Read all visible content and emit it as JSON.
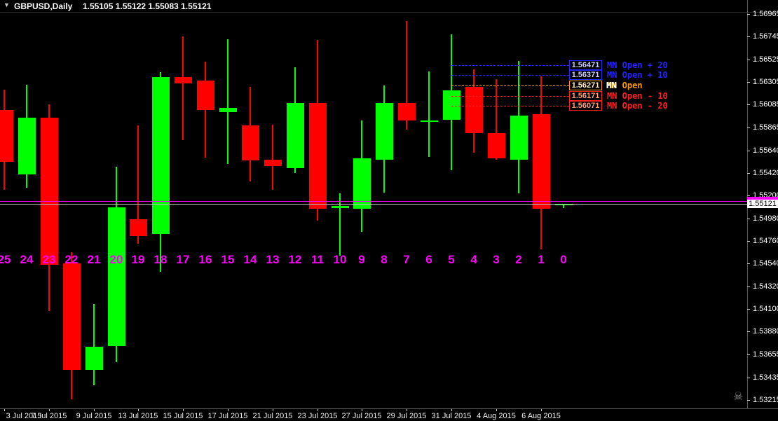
{
  "title": {
    "symbol_timeframe": "GBPUSD,Daily",
    "ohlc_quote": "1.55105 1.55122 1.55083 1.55121"
  },
  "icons": {
    "symbol_menu": "▼",
    "skull": "☠"
  },
  "price_axis": {
    "current_bid_label": "1.55121"
  },
  "chart_data": {
    "type": "candlestick",
    "title": "GBPUSD,Daily",
    "symbol": "GBPUSD",
    "timeframe": "Daily",
    "background": "#000000",
    "up_color": "#00FF00",
    "down_color": "#FF0000",
    "bar_number_color": "#FF00FF",
    "y_axis": {
      "ticks": [
        "1.56965",
        "1.56745",
        "1.56525",
        "1.56305",
        "1.56085",
        "1.55865",
        "1.55640",
        "1.55420",
        "1.55200",
        "1.54980",
        "1.54760",
        "1.54540",
        "1.54320",
        "1.54100",
        "1.53880",
        "1.53655",
        "1.53435",
        "1.53215"
      ],
      "range": [
        1.532,
        1.5698
      ]
    },
    "x_axis": {
      "labels": [
        {
          "text": "3 Jul 2015",
          "bar": 25
        },
        {
          "text": "7 Jul 2015",
          "bar": 23
        },
        {
          "text": "9 Jul 2015",
          "bar": 21
        },
        {
          "text": "13 Jul 2015",
          "bar": 19
        },
        {
          "text": "15 Jul 2015",
          "bar": 17
        },
        {
          "text": "17 Jul 2015",
          "bar": 15
        },
        {
          "text": "21 Jul 2015",
          "bar": 13
        },
        {
          "text": "23 Jul 2015",
          "bar": 11
        },
        {
          "text": "27 Jul 2015",
          "bar": 9
        },
        {
          "text": "29 Jul 2015",
          "bar": 7
        },
        {
          "text": "31 Jul 2015",
          "bar": 5
        },
        {
          "text": "4 Aug 2015",
          "bar": 3
        },
        {
          "text": "6 Aug 2015",
          "bar": 1
        }
      ]
    },
    "candles": [
      {
        "n": 25,
        "o": 1.5603,
        "h": 1.5623,
        "l": 1.5526,
        "c": 1.5553
      },
      {
        "n": 24,
        "o": 1.5541,
        "h": 1.5628,
        "l": 1.5528,
        "c": 1.5596
      },
      {
        "n": 23,
        "o": 1.5596,
        "h": 1.5609,
        "l": 1.5408,
        "c": 1.5453
      },
      {
        "n": 22,
        "o": 1.5454,
        "h": 1.5465,
        "l": 1.5322,
        "c": 1.5351
      },
      {
        "n": 21,
        "o": 1.5351,
        "h": 1.5415,
        "l": 1.5336,
        "c": 1.5373
      },
      {
        "n": 20,
        "o": 1.5374,
        "h": 1.5548,
        "l": 1.5358,
        "c": 1.5509
      },
      {
        "n": 19,
        "o": 1.5497,
        "h": 1.5588,
        "l": 1.5473,
        "c": 1.5481
      },
      {
        "n": 18,
        "o": 1.5483,
        "h": 1.564,
        "l": 1.5446,
        "c": 1.5635
      },
      {
        "n": 17,
        "o": 1.5635,
        "h": 1.5675,
        "l": 1.5574,
        "c": 1.5629
      },
      {
        "n": 16,
        "o": 1.5632,
        "h": 1.565,
        "l": 1.5557,
        "c": 1.5603
      },
      {
        "n": 15,
        "o": 1.5601,
        "h": 1.5672,
        "l": 1.5551,
        "c": 1.5605
      },
      {
        "n": 14,
        "o": 1.5588,
        "h": 1.5626,
        "l": 1.5534,
        "c": 1.5554
      },
      {
        "n": 13,
        "o": 1.5555,
        "h": 1.5589,
        "l": 1.5526,
        "c": 1.5549
      },
      {
        "n": 12,
        "o": 1.5547,
        "h": 1.5645,
        "l": 1.5542,
        "c": 1.561
      },
      {
        "n": 11,
        "o": 1.561,
        "h": 1.5671,
        "l": 1.5496,
        "c": 1.5507
      },
      {
        "n": 10,
        "o": 1.5508,
        "h": 1.5522,
        "l": 1.5462,
        "c": 1.551
      },
      {
        "n": 9,
        "o": 1.5507,
        "h": 1.5593,
        "l": 1.5485,
        "c": 1.5556
      },
      {
        "n": 8,
        "o": 1.5555,
        "h": 1.5627,
        "l": 1.5523,
        "c": 1.561
      },
      {
        "n": 7,
        "o": 1.561,
        "h": 1.569,
        "l": 1.5584,
        "c": 1.5593
      },
      {
        "n": 6,
        "o": 1.5593,
        "h": 1.5641,
        "l": 1.5558,
        "c": 1.5593
      },
      {
        "n": 5,
        "o": 1.5594,
        "h": 1.5677,
        "l": 1.5545,
        "c": 1.5622
      },
      {
        "n": 4,
        "o": 1.5626,
        "h": 1.5643,
        "l": 1.5562,
        "c": 1.5581
      },
      {
        "n": 3,
        "o": 1.5581,
        "h": 1.5633,
        "l": 1.5555,
        "c": 1.5556
      },
      {
        "n": 2,
        "o": 1.5555,
        "h": 1.5651,
        "l": 1.5522,
        "c": 1.5598
      },
      {
        "n": 1,
        "o": 1.5599,
        "h": 1.5636,
        "l": 1.5468,
        "c": 1.5507
      },
      {
        "n": 0,
        "o": 1.55105,
        "h": 1.55122,
        "l": 1.55083,
        "c": 1.55121
      }
    ],
    "mn_levels": [
      {
        "price": 1.56471,
        "label": "1.56471",
        "text": "MN Open + 20",
        "color": "#2323ff",
        "box_text_color": "#c9c9ff",
        "white_overlap": false
      },
      {
        "price": 1.56371,
        "label": "1.56371",
        "text": "MN Open + 10",
        "color": "#2323ff",
        "box_text_color": "#c9c9ff",
        "white_overlap": false
      },
      {
        "price": 1.56271,
        "label": "1.56271",
        "text": "MN Open",
        "color": "#ff9900",
        "box_text_color": "#ffe9c4",
        "white_overlap": true
      },
      {
        "price": 1.56171,
        "label": "1.56171",
        "text": "MN Open - 10",
        "color": "#ff2020",
        "box_text_color": "#ff9977",
        "white_overlap": false
      },
      {
        "price": 1.56071,
        "label": "1.56071",
        "text": "MN Open - 20",
        "color": "#ff2020",
        "box_text_color": "#ff9977",
        "white_overlap": false
      }
    ],
    "hlines": [
      {
        "name": "magenta-hline",
        "price": 1.55148,
        "color": "#FF00FF"
      },
      {
        "name": "bid-line",
        "price": 1.55121,
        "color": "#c0c0c0"
      }
    ]
  }
}
